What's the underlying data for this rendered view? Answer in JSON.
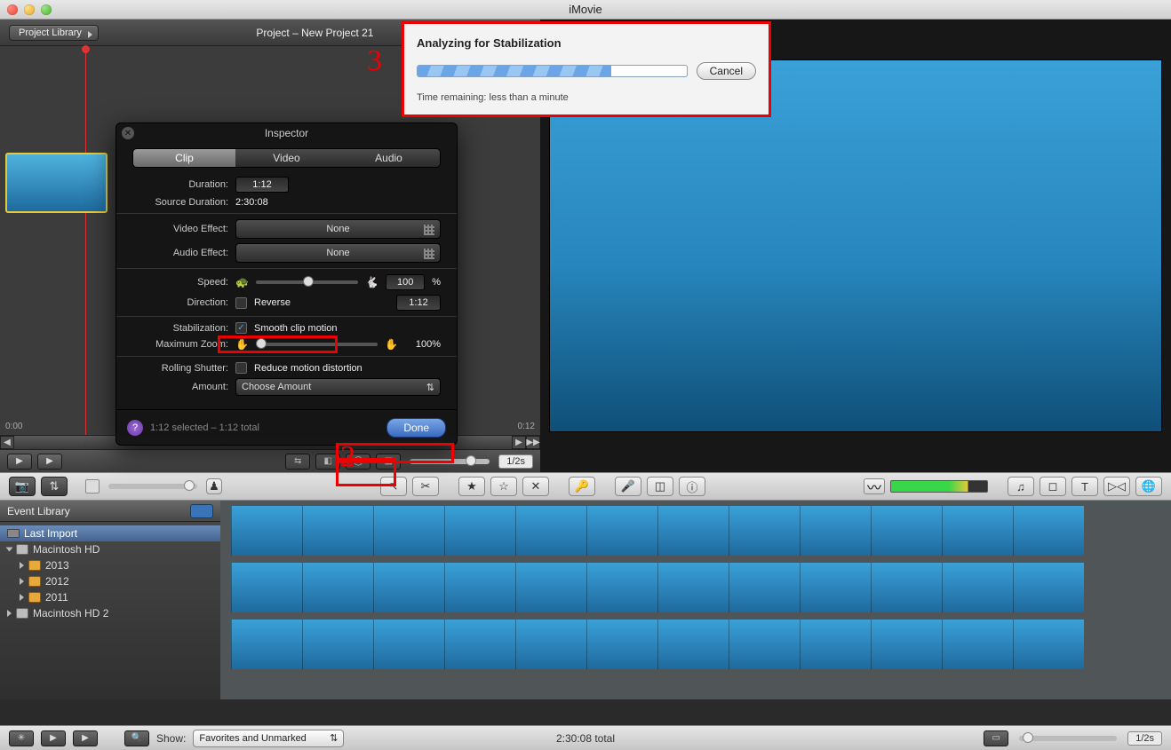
{
  "window": {
    "title": "iMovie"
  },
  "project": {
    "library_button": "Project Library",
    "title": "Project – New Project 21",
    "time_start": "0:00",
    "time_end": "0:12"
  },
  "project_footer": {
    "selection_status": "1:12 selected – 1:12 total",
    "zoom_label": "1/2s"
  },
  "inspector": {
    "title": "Inspector",
    "tabs": {
      "clip": "Clip",
      "video": "Video",
      "audio": "Audio"
    },
    "duration_label": "Duration:",
    "duration_value": "1:12",
    "source_duration_label": "Source Duration:",
    "source_duration_value": "2:30:08",
    "video_effect_label": "Video Effect:",
    "video_effect_value": "None",
    "audio_effect_label": "Audio Effect:",
    "audio_effect_value": "None",
    "speed_label": "Speed:",
    "speed_value": "100",
    "speed_unit": "%",
    "direction_label": "Direction:",
    "direction_reverse": "Reverse",
    "direction_value": "1:12",
    "stabilization_label": "Stabilization:",
    "stabilization_check": "Smooth clip motion",
    "max_zoom_label": "Maximum Zoom:",
    "max_zoom_value": "100%",
    "rolling_shutter_label": "Rolling Shutter:",
    "rolling_shutter_check": "Reduce motion distortion",
    "amount_label": "Amount:",
    "amount_value": "Choose Amount",
    "footer_status": "1:12 selected – 1:12 total",
    "done": "Done"
  },
  "analyze": {
    "title": "Analyzing for Stabilization",
    "cancel": "Cancel",
    "time_remaining": "Time remaining: less than a minute"
  },
  "event_library": {
    "title": "Event Library",
    "items": {
      "last_import": "Last Import",
      "mac_hd": "Macintosh HD",
      "y2013": "2013",
      "y2012": "2012",
      "y2011": "2011",
      "mac_hd2": "Macintosh HD 2"
    }
  },
  "bottom": {
    "show_label": "Show:",
    "show_value": "Favorites and Unmarked",
    "total": "2:30:08 total",
    "zoom_label": "1/2s"
  },
  "annotations": {
    "n2": "2",
    "n3": "3"
  }
}
